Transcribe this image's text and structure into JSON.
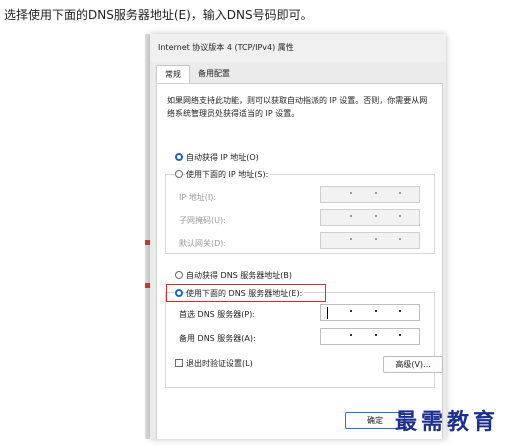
{
  "caption": "选择使用下面的DNS服务器地址(E)，输入DNS号码即可。",
  "dialog": {
    "title": "Internet 协议版本 4 (TCP/IPv4) 属性",
    "tabs": [
      {
        "label": "常规",
        "active": true
      },
      {
        "label": "备用配置",
        "active": false
      }
    ],
    "description": "如果网络支持此功能，则可以获取自动指派的 IP 设置。否则，你需要从网络系统管理员处获得适当的 IP 设置。",
    "ip_auto_label": "自动获得 IP 地址(O)",
    "ip_manual_label": "使用下面的 IP 地址(S):",
    "ip_fields": [
      {
        "label": "IP 地址(I):"
      },
      {
        "label": "子网掩码(U):"
      },
      {
        "label": "默认网关(D):"
      }
    ],
    "dns_auto_label": "自动获得 DNS 服务器地址(B)",
    "dns_manual_label": "使用下面的 DNS 服务器地址(E):",
    "dns_fields": [
      {
        "label": "首选 DNS 服务器(P):"
      },
      {
        "label": "备用 DNS 服务器(A):"
      }
    ],
    "validate_label": "退出时验证设置(L)",
    "advanced_label": "高级(V)...",
    "ok_label": "确定"
  },
  "watermark": "最需教育",
  "colors": {
    "selected_radio": "#1a64c8",
    "highlight": "#d62b2b",
    "watermark": "#1b2f8f"
  }
}
